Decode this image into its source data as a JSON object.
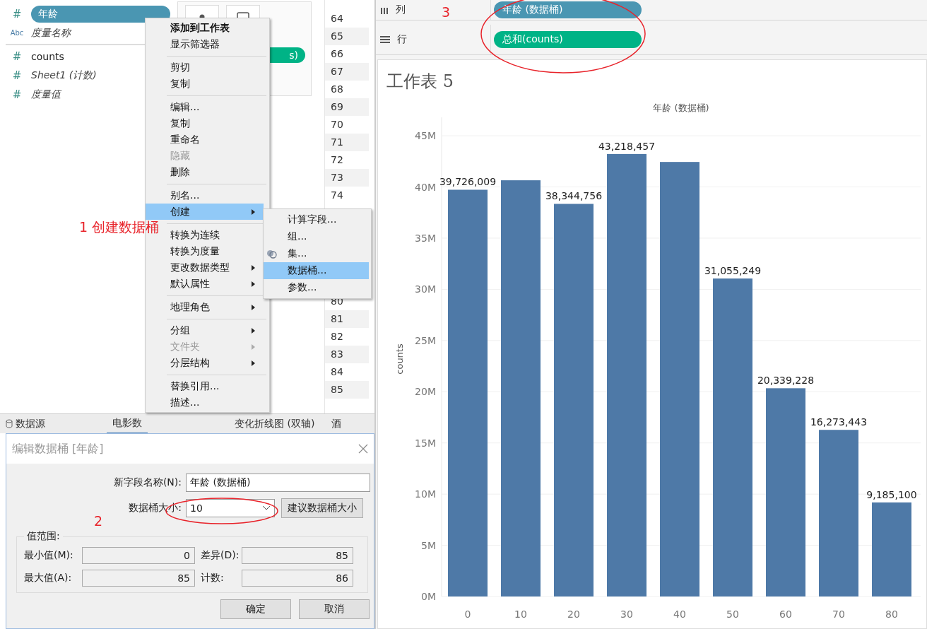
{
  "fields": [
    {
      "type_icon": "#",
      "name": "年龄",
      "selected": true,
      "generated": false
    },
    {
      "type_icon": "Abc",
      "name": "度量名称",
      "selected": false,
      "generated": true
    },
    {
      "type_icon": "#",
      "name": "counts",
      "selected": false,
      "generated": false
    },
    {
      "type_icon": "#",
      "name": "Sheet1 (计数)",
      "selected": false,
      "generated": true
    },
    {
      "type_icon": "#",
      "name": "度量值",
      "selected": false,
      "generated": true
    }
  ],
  "marks_card": {
    "pill": "s)"
  },
  "number_column": {
    "upper": [
      "64",
      "65",
      "66",
      "67",
      "68",
      "69",
      "70",
      "71",
      "72",
      "73",
      "74"
    ],
    "lower": [
      "80",
      "81",
      "82",
      "83",
      "84",
      "85"
    ]
  },
  "sheet_tabs": [
    {
      "label": "数据源",
      "selected": false
    },
    {
      "label": "电影数",
      "selected": true
    },
    {
      "label": "变化折线图 (双轴)",
      "selected": false
    },
    {
      "label": "酒",
      "selected": false
    }
  ],
  "context_menu": [
    {
      "kind": "item",
      "label": "添加到工作表",
      "bold": true,
      "disabled": false,
      "submenu": false,
      "selected": false
    },
    {
      "kind": "item",
      "label": "显示筛选器",
      "bold": false,
      "disabled": false,
      "submenu": false,
      "selected": false
    },
    {
      "kind": "separator"
    },
    {
      "kind": "item",
      "label": "剪切",
      "bold": false,
      "disabled": false,
      "submenu": false,
      "selected": false
    },
    {
      "kind": "item",
      "label": "复制",
      "bold": false,
      "disabled": false,
      "submenu": false,
      "selected": false
    },
    {
      "kind": "separator"
    },
    {
      "kind": "item",
      "label": "编辑...",
      "bold": false,
      "disabled": false,
      "submenu": false,
      "selected": false
    },
    {
      "kind": "item",
      "label": "复制",
      "bold": false,
      "disabled": false,
      "submenu": false,
      "selected": false
    },
    {
      "kind": "item",
      "label": "重命名",
      "bold": false,
      "disabled": false,
      "submenu": false,
      "selected": false
    },
    {
      "kind": "item",
      "label": "隐藏",
      "bold": false,
      "disabled": true,
      "submenu": false,
      "selected": false
    },
    {
      "kind": "item",
      "label": "删除",
      "bold": false,
      "disabled": false,
      "submenu": false,
      "selected": false
    },
    {
      "kind": "separator"
    },
    {
      "kind": "item",
      "label": "别名...",
      "bold": false,
      "disabled": false,
      "submenu": false,
      "selected": false
    },
    {
      "kind": "item",
      "label": "创建",
      "bold": false,
      "disabled": false,
      "submenu": true,
      "selected": true
    },
    {
      "kind": "separator"
    },
    {
      "kind": "item",
      "label": "转换为连续",
      "bold": false,
      "disabled": false,
      "submenu": false,
      "selected": false
    },
    {
      "kind": "item",
      "label": "转换为度量",
      "bold": false,
      "disabled": false,
      "submenu": false,
      "selected": false
    },
    {
      "kind": "item",
      "label": "更改数据类型",
      "bold": false,
      "disabled": false,
      "submenu": true,
      "selected": false
    },
    {
      "kind": "item",
      "label": "默认属性",
      "bold": false,
      "disabled": false,
      "submenu": true,
      "selected": false
    },
    {
      "kind": "separator"
    },
    {
      "kind": "item",
      "label": "地理角色",
      "bold": false,
      "disabled": false,
      "submenu": true,
      "selected": false
    },
    {
      "kind": "separator"
    },
    {
      "kind": "item",
      "label": "分组",
      "bold": false,
      "disabled": false,
      "submenu": true,
      "selected": false
    },
    {
      "kind": "item",
      "label": "文件夹",
      "bold": false,
      "disabled": true,
      "submenu": true,
      "selected": false
    },
    {
      "kind": "item",
      "label": "分层结构",
      "bold": false,
      "disabled": false,
      "submenu": true,
      "selected": false
    },
    {
      "kind": "separator"
    },
    {
      "kind": "item",
      "label": "替换引用...",
      "bold": false,
      "disabled": false,
      "submenu": false,
      "selected": false
    },
    {
      "kind": "item",
      "label": "描述...",
      "bold": false,
      "disabled": false,
      "submenu": false,
      "selected": false
    }
  ],
  "submenu": [
    {
      "label": "计算字段...",
      "icon": false,
      "selected": false
    },
    {
      "label": "组...",
      "icon": false,
      "selected": false
    },
    {
      "label": "集...",
      "icon": true,
      "selected": false
    },
    {
      "label": "数据桶...",
      "icon": false,
      "selected": true
    },
    {
      "label": "参数...",
      "icon": false,
      "selected": false
    }
  ],
  "dialog": {
    "title": "编辑数据桶 [年龄]",
    "name_label": "新字段名称(N):",
    "name_value": "年龄 (数据桶)",
    "size_label": "数据桶大小:",
    "size_value": "10",
    "suggest_button": "建议数据桶大小",
    "range_legend": "值范围:",
    "range": [
      {
        "label": "最小值(M):",
        "value": "0"
      },
      {
        "label": "差异(D):",
        "value": "85"
      },
      {
        "label": "最大值(A):",
        "value": "85"
      },
      {
        "label": "计数:",
        "value": "86"
      }
    ],
    "buttons": [
      "确定",
      "取消"
    ]
  },
  "shelves": [
    {
      "kind": "columns",
      "label": "列",
      "pill": "年龄 (数据桶)"
    },
    {
      "kind": "rows",
      "label": "行",
      "pill": "总和(counts)"
    }
  ],
  "worksheet": {
    "title": "工作表 5",
    "chart_data": {
      "type": "bar",
      "title": "年龄 (数据桶)",
      "ylabel": "counts",
      "categories": [
        "0",
        "10",
        "20",
        "30",
        "40",
        "50",
        "60",
        "70",
        "80"
      ],
      "grid": true,
      "series": [
        {
          "color": "#4e79a7",
          "values": [
            39726009,
            40650000,
            38344756,
            43218457,
            42440000,
            31055249,
            20339228,
            16273443,
            9185100
          ]
        }
      ],
      "ylim": [
        0,
        46800000
      ],
      "yticks": [
        {
          "value": 0,
          "label": "0M"
        },
        {
          "value": 5000000,
          "label": "5M"
        },
        {
          "value": 10000000,
          "label": "10M"
        },
        {
          "value": 15000000,
          "label": "15M"
        },
        {
          "value": 20000000,
          "label": "20M"
        },
        {
          "value": 25000000,
          "label": "25M"
        },
        {
          "value": 30000000,
          "label": "30M"
        },
        {
          "value": 35000000,
          "label": "35M"
        },
        {
          "value": 40000000,
          "label": "40M"
        },
        {
          "value": 45000000,
          "label": "45M"
        }
      ],
      "value_labels": [
        "39,726,009",
        null,
        "38,344,756",
        "43,218,457",
        null,
        "31,055,249",
        "20,339,228",
        "16,273,443",
        "9,185,100"
      ]
    }
  },
  "annotations": [
    "1 创建数据桶",
    "2",
    "3"
  ]
}
